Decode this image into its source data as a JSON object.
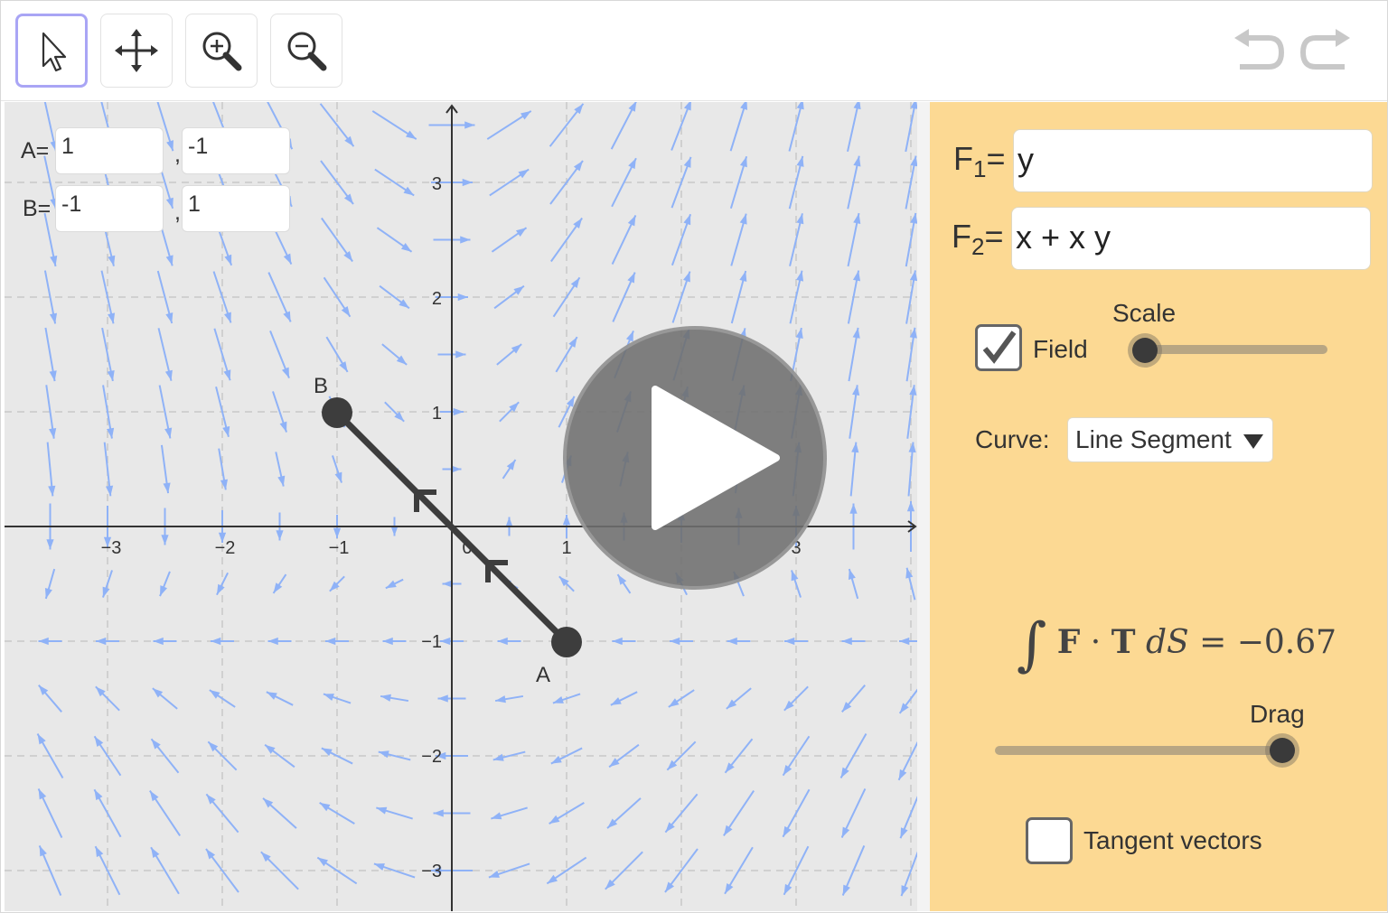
{
  "toolbar": {
    "tools": [
      {
        "name": "move",
        "icon": "arrow-pointer-icon",
        "active": true
      },
      {
        "name": "move-graphics-view",
        "icon": "move-arrows-icon",
        "active": false
      },
      {
        "name": "zoom-in",
        "icon": "zoom-in-icon",
        "active": false
      },
      {
        "name": "zoom-out",
        "icon": "zoom-out-icon",
        "active": false
      }
    ],
    "undo_icon": "undo-icon",
    "redo_icon": "redo-icon"
  },
  "points": {
    "A": {
      "label": "A=",
      "x": "1",
      "y": "-1",
      "separator": ","
    },
    "B": {
      "label": "B=",
      "x": "-1",
      "y": "1",
      "separator": ","
    }
  },
  "graph": {
    "x_ticks": [
      "−3",
      "−2",
      "−1",
      "0",
      "1",
      "3"
    ],
    "y_ticks": [
      "3",
      "2",
      "1",
      "−1",
      "−2",
      "−3"
    ],
    "point_labels": {
      "A": "A",
      "B": "B"
    },
    "colors": {
      "field_arrow": "#8fb2f7",
      "segment": "#3d3d3d",
      "grid": "#c8c8c8",
      "axis": "#333333"
    }
  },
  "panel": {
    "f1": {
      "label": "F",
      "sub": "1",
      "eq": "=",
      "value": "y"
    },
    "f2": {
      "label": "F",
      "sub": "2",
      "eq": "=",
      "value": "x + x y"
    },
    "field_checkbox": {
      "label": "Field",
      "checked": true
    },
    "scale_slider": {
      "label": "Scale",
      "value": 0.0
    },
    "curve": {
      "label": "Curve:",
      "selected": "Line Segment"
    },
    "integral": {
      "text": "∫ F · T dS = −0.67",
      "value": -0.67
    },
    "drag_slider": {
      "label": "Drag",
      "value": 1.0
    },
    "tangent_checkbox": {
      "label": "Tangent vectors",
      "checked": false
    },
    "background": "#fcd993"
  },
  "overlay": {
    "icon": "play-icon"
  }
}
